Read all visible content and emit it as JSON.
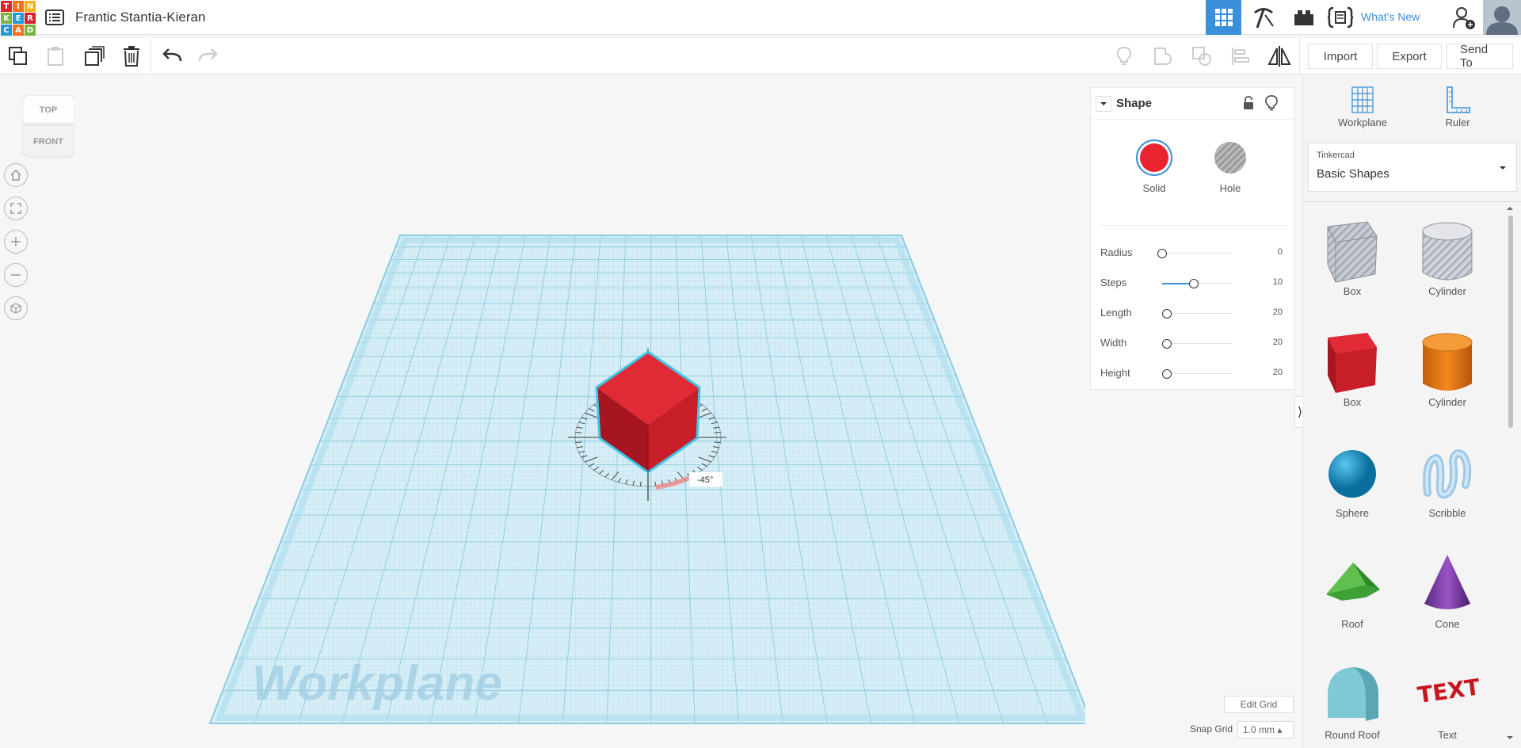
{
  "header": {
    "logo_letters": [
      "T",
      "I",
      "N",
      "K",
      "E",
      "R",
      "C",
      "A",
      "D"
    ],
    "logo_colors": [
      "#e2242c",
      "#f37121",
      "#f9b019",
      "#7ab63f",
      "#1f9ad6",
      "#d5222d",
      "#1f9ad6",
      "#f37121",
      "#7ab63f"
    ],
    "design_title": "Frantic Stantia-Kieran",
    "whats_new": "What's New",
    "accent": "#3b8fd9"
  },
  "toolbar": {
    "import_label": "Import",
    "export_label": "Export",
    "send_to_label": "Send To"
  },
  "viewcube": {
    "top": "TOP",
    "front": "FRONT"
  },
  "workplane_label": "Workplane",
  "rotation_readout": "-45°",
  "shape_panel": {
    "title": "Shape",
    "solid_label": "Solid",
    "hole_label": "Hole",
    "solid_color": "#e9242e",
    "params": [
      {
        "label": "Radius",
        "value": "0",
        "level": 0
      },
      {
        "label": "Steps",
        "value": "10",
        "level": 0.45
      },
      {
        "label": "Length",
        "value": "20",
        "level": 0.07
      },
      {
        "label": "Width",
        "value": "20",
        "level": 0.07
      },
      {
        "label": "Height",
        "value": "20",
        "level": 0.07
      }
    ]
  },
  "library": {
    "workplane_label": "Workplane",
    "ruler_label": "Ruler",
    "category_group": "Tinkercad",
    "category_selected": "Basic Shapes",
    "shapes": [
      {
        "label": "Box",
        "icon": "hatched-box-icon"
      },
      {
        "label": "Cylinder",
        "icon": "hatched-cylinder-icon"
      },
      {
        "label": "Box",
        "icon": "red-box-icon"
      },
      {
        "label": "Cylinder",
        "icon": "orange-cylinder-icon"
      },
      {
        "label": "Sphere",
        "icon": "blue-sphere-icon"
      },
      {
        "label": "Scribble",
        "icon": "scribble-icon"
      },
      {
        "label": "Roof",
        "icon": "green-roof-icon"
      },
      {
        "label": "Cone",
        "icon": "purple-cone-icon"
      },
      {
        "label": "Round Roof",
        "icon": "round-roof-icon"
      },
      {
        "label": "Text",
        "icon": "red-text-icon"
      }
    ]
  },
  "bottom": {
    "edit_grid": "Edit Grid",
    "snap_grid_label": "Snap Grid",
    "snap_grid_value": "1.0 mm ▴"
  }
}
